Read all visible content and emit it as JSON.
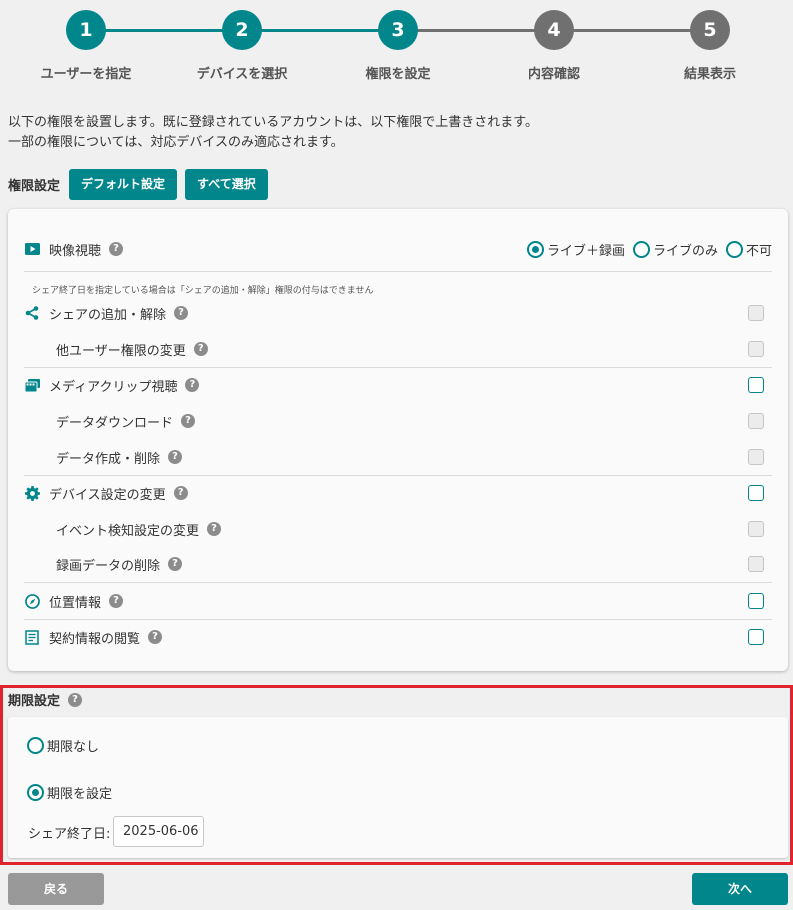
{
  "colors": {
    "accent": "#00868b",
    "inactive_step": "#707070",
    "highlight_border": "#e0232c",
    "back_button": "#999999"
  },
  "steps": [
    {
      "number": "1",
      "label": "ユーザーを指定",
      "state": "done"
    },
    {
      "number": "2",
      "label": "デバイスを選択",
      "state": "done"
    },
    {
      "number": "3",
      "label": "権限を設定",
      "state": "current"
    },
    {
      "number": "4",
      "label": "内容確認",
      "state": "pending"
    },
    {
      "number": "5",
      "label": "結果表示",
      "state": "pending"
    }
  ],
  "intro": {
    "line1": "以下の権限を設置します。既に登録されているアカウントは、以下権限で上書きされます。",
    "line2": "一部の権限については、対応デバイスのみ適応されます。"
  },
  "permissions": {
    "title": "権限設定",
    "default_button": "デフォルト設定",
    "select_all_button": "すべて選択",
    "video": {
      "label": "映像視聴",
      "icon": "play-icon",
      "options": [
        "ライブ＋録画",
        "ライブのみ",
        "不可"
      ],
      "selected": "ライブ＋録画"
    },
    "share_note": "シェア終了日を指定している場合は「シェアの追加・解除」権限の付与はできません",
    "items": [
      {
        "label": "シェアの追加・解除",
        "icon": "share-icon",
        "checked": false,
        "enabled": false
      },
      {
        "label": "他ユーザー権限の変更",
        "icon": "",
        "checked": false,
        "enabled": false
      },
      {
        "label": "メディアクリップ視聴",
        "icon": "media-clip-icon",
        "checked": false,
        "enabled": true
      },
      {
        "label": "データダウンロード",
        "icon": "",
        "checked": false,
        "enabled": false
      },
      {
        "label": "データ作成・削除",
        "icon": "",
        "checked": false,
        "enabled": false
      },
      {
        "label": "デバイス設定の変更",
        "icon": "gear-icon",
        "checked": false,
        "enabled": true
      },
      {
        "label": "イベント検知設定の変更",
        "icon": "",
        "checked": false,
        "enabled": false
      },
      {
        "label": "録画データの削除",
        "icon": "",
        "checked": false,
        "enabled": false
      },
      {
        "label": "位置情報",
        "icon": "compass-icon",
        "checked": false,
        "enabled": true
      },
      {
        "label": "契約情報の閲覧",
        "icon": "document-icon",
        "checked": false,
        "enabled": true
      }
    ]
  },
  "period": {
    "title": "期限設定",
    "options": [
      "期限なし",
      "期限を設定"
    ],
    "selected": "期限を設定",
    "end_date_label": "シェア終了日:",
    "end_date_value": "2025-06-06"
  },
  "nav": {
    "back": "戻る",
    "next": "次へ"
  }
}
